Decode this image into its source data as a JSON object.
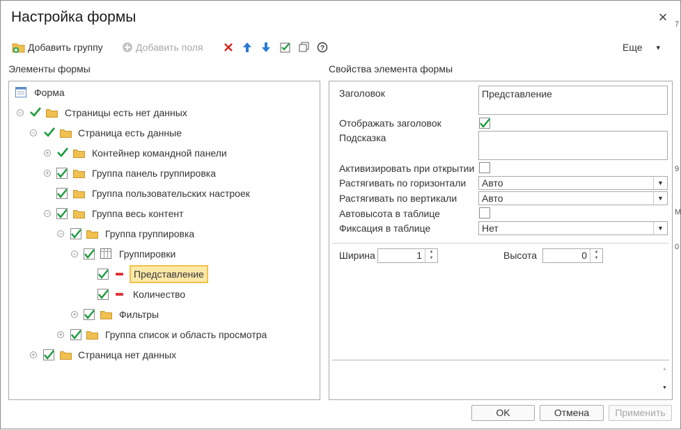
{
  "window": {
    "title": "Настройка формы",
    "close_glyph": "×"
  },
  "background_edge": [
    "7",
    "9",
    "M",
    "0"
  ],
  "toolbar": {
    "add_group": "Добавить группу",
    "add_fields": "Добавить поля",
    "more": "Еще",
    "more_arrow": "▾",
    "icons": [
      "delete-icon",
      "move-up-icon",
      "move-down-icon",
      "check-all-icon",
      "copy-icon",
      "help-icon"
    ]
  },
  "tree_panel": {
    "label": "Элементы формы",
    "nodes": [
      "Форма",
      "Страницы есть нет данных",
      "Страница есть данные",
      "Контейнер командной панели",
      "Группа панель группировка",
      "Группа пользовательских настроек",
      "Группа весь контент",
      "Группа группировка",
      "Группировки",
      "Представление",
      "Количество",
      "Фильтры",
      "Группа список и область просмотра",
      "Страница нет данных"
    ]
  },
  "props_panel": {
    "label": "Свойства элемента формы",
    "title_label": "Заголовок",
    "title_value": "Представление",
    "show_title_label": "Отображать заголовок",
    "show_title_checked": true,
    "hint_label": "Подсказка",
    "hint_value": "",
    "activate_label": "Активизировать при открытии",
    "activate_checked": false,
    "stretch_h_label": "Растягивать по горизонтали",
    "stretch_h_value": "Авто",
    "stretch_v_label": "Растягивать по вертикали",
    "stretch_v_value": "Авто",
    "autoheight_label": "Автовысота в таблице",
    "autoheight_checked": false,
    "fix_label": "Фиксация в таблице",
    "fix_value": "Нет",
    "width_label": "Ширина",
    "width_value": "1",
    "height_label": "Высота",
    "height_value": "0"
  },
  "buttons": {
    "ok": "OK",
    "cancel": "Отмена",
    "apply": "Применить"
  },
  "colors": {
    "check_green": "#1a9a3c",
    "folder_yellow": "#f0c050",
    "selection": "#fde9a8",
    "delete_red": "#d9261c",
    "arrow_blue": "#2a7ad5"
  }
}
